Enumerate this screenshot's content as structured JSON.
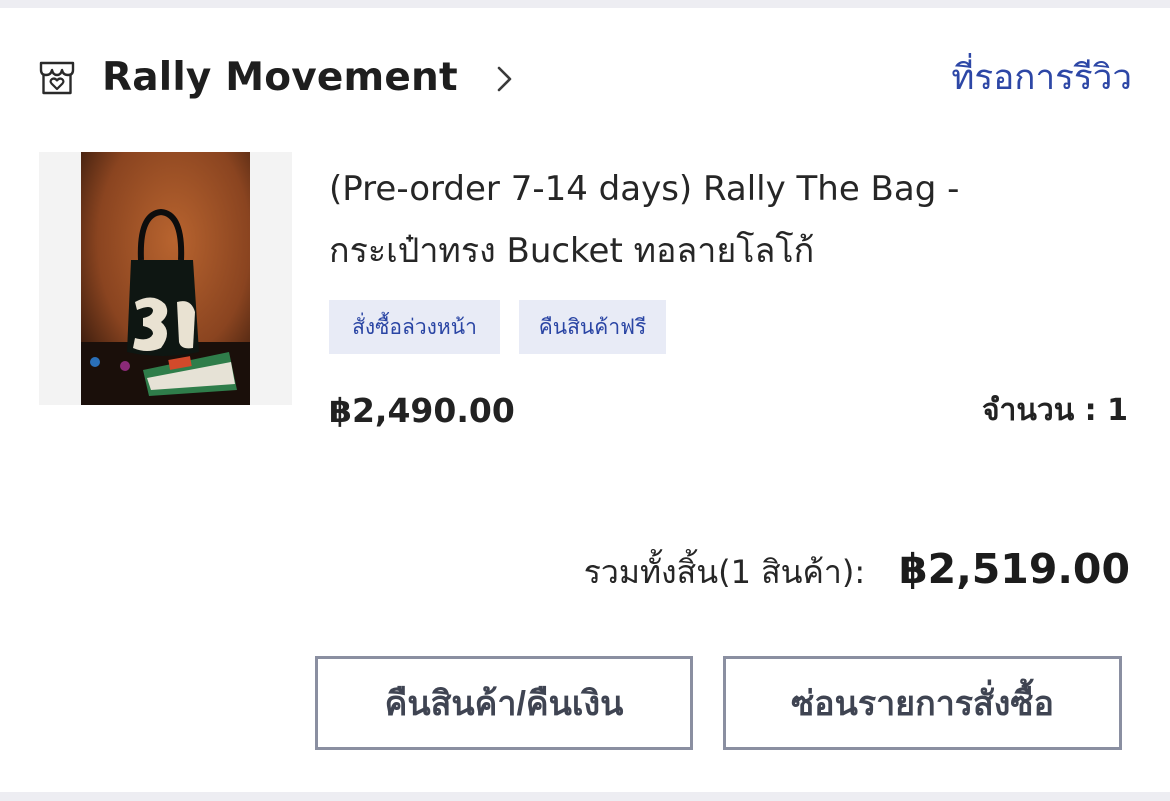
{
  "shop": {
    "icon": "shop-icon",
    "name": "Rally Movement",
    "chevron_icon": "chevron-right-icon",
    "status_link": "ที่รอการรีวิว"
  },
  "product": {
    "thumbnail_icon": "product-thumbnail",
    "title_line1": "(Pre-order 7-14 days) Rally The Bag -",
    "title_line2": "กระเป๋าทรง Bucket ทอลายโลโก้",
    "tags": [
      "สั่งซื้อล่วงหน้า",
      "คืนสินค้าฟรี"
    ],
    "price": "฿2,490.00",
    "quantity": "จำนวน : 1"
  },
  "summary": {
    "label": "รวมทั้งสิ้น(1 สินค้า):",
    "total": "฿2,519.00"
  },
  "actions": {
    "refund_label": "คืนสินค้า/คืนเงิน",
    "hide_label": "ซ่อนรายการสั่งซื้อ"
  },
  "colors": {
    "link_blue": "#2d47a6",
    "tag_bg": "#e8ebf6",
    "button_border": "#8a8fa1"
  }
}
